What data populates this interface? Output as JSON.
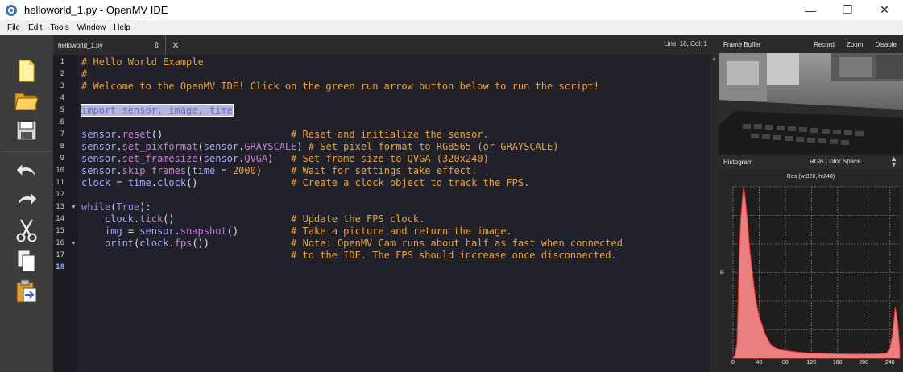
{
  "window": {
    "title": "helloworld_1.py - OpenMV IDE",
    "minimize": "—",
    "maximize": "❐",
    "close": "✕"
  },
  "menu": [
    "File",
    "Edit",
    "Tools",
    "Window",
    "Help"
  ],
  "toolbar": {
    "icons": [
      "new-file-icon",
      "open-folder-icon",
      "save-icon",
      "undo-icon",
      "redo-icon",
      "cut-icon",
      "copy-icon",
      "paste-icon"
    ]
  },
  "editor": {
    "tab_label": "helloworld_1.py",
    "tab_arrows": "⇕",
    "close_label": "×",
    "position": "Line: 18, Col: 1",
    "lines": [
      {
        "n": "1",
        "t": "# Hello World Example"
      },
      {
        "n": "2",
        "t": "#"
      },
      {
        "n": "3",
        "t": "# Welcome to the OpenMV IDE! Click on the green run arrow button below to run the script!"
      },
      {
        "n": "4",
        "t": ""
      },
      {
        "n": "5",
        "t": "import sensor, image, time"
      },
      {
        "n": "6",
        "t": ""
      },
      {
        "n": "7",
        "t": "sensor.reset()                      # Reset and initialize the sensor."
      },
      {
        "n": "8",
        "t": "sensor.set_pixformat(sensor.GRAYSCALE) # Set pixel format to RGB565 (or GRAYSCALE)"
      },
      {
        "n": "9",
        "t": "sensor.set_framesize(sensor.QVGA)   # Set frame size to QVGA (320x240)"
      },
      {
        "n": "10",
        "t": "sensor.skip_frames(time = 2000)     # Wait for settings take effect."
      },
      {
        "n": "11",
        "t": "clock = time.clock()                # Create a clock object to track the FPS."
      },
      {
        "n": "12",
        "t": ""
      },
      {
        "n": "13",
        "t": "while(True):"
      },
      {
        "n": "14",
        "t": "    clock.tick()                    # Update the FPS clock."
      },
      {
        "n": "15",
        "t": "    img = sensor.snapshot()         # Take a picture and return the image."
      },
      {
        "n": "16",
        "t": "    print(clock.fps())              # Note: OpenMV Cam runs about half as fast when connected"
      },
      {
        "n": "17",
        "t": "                                    # to the IDE. The FPS should increase once disconnected."
      },
      {
        "n": "18",
        "t": ""
      }
    ]
  },
  "frame_buffer": {
    "title": "Frame Buffer",
    "record": "Record",
    "zoom": "Zoom",
    "disable": "Disable"
  },
  "histogram": {
    "title": "Histogram",
    "color_space": "RGB Color Space",
    "resolution": "Res (w:320, h:240)",
    "y_axis_label": "R",
    "x_ticks": [
      "0",
      "40",
      "80",
      "120",
      "160",
      "200",
      "240"
    ],
    "fill_color": "#ff8a8a",
    "line_color": "#ff3030",
    "bins_x": [
      0,
      3,
      6,
      8,
      10,
      12,
      14,
      16,
      18,
      20,
      22,
      24,
      26,
      28,
      30,
      32,
      34,
      36,
      38,
      40,
      44,
      48,
      52,
      56,
      60,
      66,
      72,
      80,
      90,
      100,
      110,
      120,
      140,
      160,
      180,
      200,
      220,
      235,
      240,
      244,
      248,
      252,
      255
    ],
    "bins_y": [
      0,
      2,
      8,
      35,
      65,
      82,
      92,
      100,
      96,
      88,
      80,
      70,
      62,
      55,
      48,
      42,
      36,
      32,
      28,
      24,
      20,
      15,
      12,
      9,
      7,
      6,
      5,
      4.5,
      4,
      3.5,
      3.2,
      3,
      2.8,
      2.6,
      2.5,
      2.5,
      2.6,
      3,
      6,
      14,
      30,
      20,
      5
    ]
  }
}
